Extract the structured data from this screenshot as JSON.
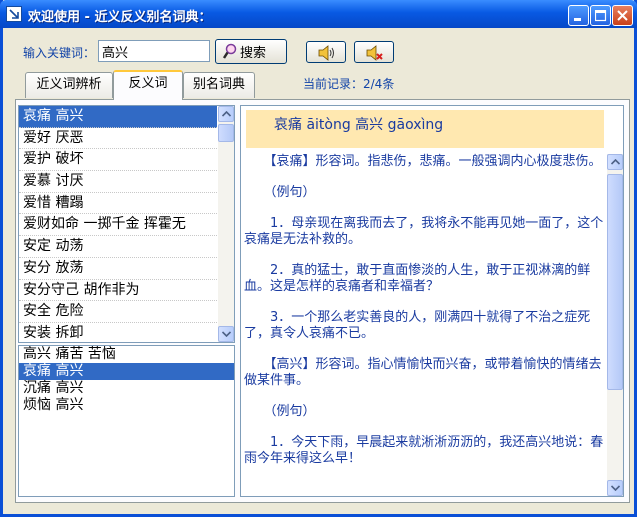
{
  "window": {
    "title": "欢迎使用 - 近义反义别名词典："
  },
  "search": {
    "label": "输入关键词：",
    "value": "高兴",
    "button_label": "搜索"
  },
  "tabs": [
    {
      "label": "近义词辨析",
      "active": false
    },
    {
      "label": "反义词",
      "active": true
    },
    {
      "label": "别名词典",
      "active": false
    }
  ],
  "record": "当前记录：2/4条",
  "top_list": [
    {
      "text": "哀痛   高兴",
      "selected": true
    },
    {
      "text": "爱好   厌恶",
      "selected": false
    },
    {
      "text": "爱护   破坏",
      "selected": false
    },
    {
      "text": "爱慕   讨厌",
      "selected": false
    },
    {
      "text": "爱惜   糟蹋",
      "selected": false
    },
    {
      "text": "爱财如命   一掷千金   挥霍无",
      "selected": false
    },
    {
      "text": "安定   动荡",
      "selected": false
    },
    {
      "text": "安分   放荡",
      "selected": false
    },
    {
      "text": "安分守己   胡作非为",
      "selected": false
    },
    {
      "text": "安全   危险",
      "selected": false
    },
    {
      "text": "安装   拆卸",
      "selected": false
    }
  ],
  "bottom_list": [
    {
      "text": "高兴   痛苦   苦恼",
      "selected": false
    },
    {
      "text": "哀痛   高兴",
      "selected": true
    },
    {
      "text": "沉痛   高兴",
      "selected": false
    },
    {
      "text": "烦恼   高兴",
      "selected": false
    }
  ],
  "detail": {
    "headword": "哀痛 āitòng 高兴 gāoxìng",
    "paragraphs": [
      "　　【哀痛】形容词。指悲伤，悲痛。一般强调内心极度悲伤。",
      "　　（例句）",
      "　　1．母亲现在离我而去了，我将永不能再见她一面了，这个哀痛是无法补救的。",
      "　　2．真的猛士，敢于直面惨淡的人生，敢于正视淋漓的鲜血。这是怎样的哀痛者和幸福者？",
      "　　3．一个那么老实善良的人，刚满四十就得了不治之症死了，真令人哀痛不已。",
      "　　【高兴】形容词。指心情愉快而兴奋，或带着愉快的情绪去做某件事。",
      "　　（例句）",
      "　　1．今天下雨，早晨起来就淅淅沥沥的，我还高兴地说：春雨今年来得这么早！"
    ]
  },
  "icons": {
    "app": "app-icon",
    "search": "magnifier-icon",
    "sound1": "speaker-icon",
    "sound2": "speaker-mute-icon"
  },
  "colors": {
    "title_bar": "#0859e3",
    "label_text": "#1244a8",
    "selection": "#316ac5",
    "headword_bg": "#ffe8b0",
    "detail_text": "#1a3ba0"
  }
}
